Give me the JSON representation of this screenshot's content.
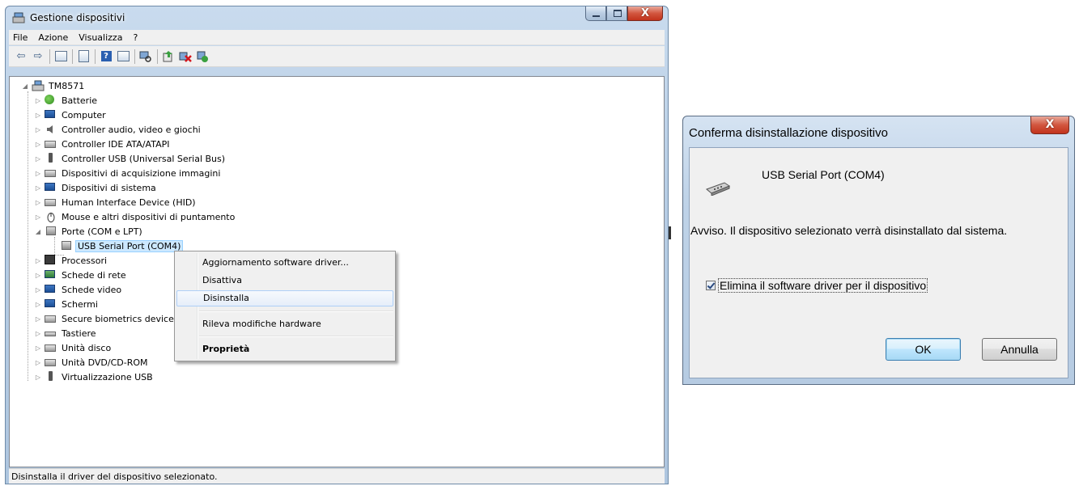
{
  "device_manager": {
    "title": "Gestione dispositivi",
    "menu": [
      "File",
      "Azione",
      "Visualizza",
      "?"
    ],
    "tree": {
      "root": "TM8571",
      "categories": [
        "Batterie",
        "Computer",
        "Controller audio, video e giochi",
        "Controller IDE ATA/ATAPI",
        "Controller USB (Universal Serial Bus)",
        "Dispositivi di acquisizione immagini",
        "Dispositivi di sistema",
        "Human Interface Device (HID)",
        "Mouse e altri dispositivi di puntamento",
        "Porte (COM e LPT)",
        "USB Serial Port (COM4)",
        "Processori",
        "Schede di rete",
        "Schede video",
        "Schermi",
        "Secure biometrics device",
        "Tastiere",
        "Unità disco",
        "Unità DVD/CD-ROM",
        "Virtualizzazione USB"
      ],
      "selected": "USB Serial Port (COM4)"
    },
    "status_text": "Disinstalla il driver del dispositivo selezionato."
  },
  "context_menu": {
    "update_driver": "Aggiornamento software driver...",
    "disable": "Disattiva",
    "uninstall": "Disinstalla",
    "scan_hardware": "Rileva modifiche hardware",
    "properties": "Proprietà",
    "highlighted": "Disinstalla"
  },
  "dialog": {
    "title": "Conferma disinstallazione dispositivo",
    "close_glyph": "X",
    "device_name": "USB Serial Port (COM4)",
    "warning": "Avviso. Il dispositivo selezionato verrà disinstallato dal sistema.",
    "checkbox_label": "Elimina il software driver per il dispositivo",
    "checkbox_checked": true,
    "ok_label": "OK",
    "cancel_label": "Annulla"
  },
  "icons": {
    "title": "device-manager-icon",
    "toolbar": [
      "back-arrow-icon",
      "forward-arrow-icon",
      "console-tree-icon",
      "properties-sheet-icon",
      "help-icon",
      "view-icon",
      "scan-hardware-icon",
      "update-driver-icon",
      "uninstall-icon",
      "enable-icon"
    ]
  },
  "colors": {
    "selection": "#cce8ff",
    "close_button": "#c2331c",
    "window_frame": "#b7cde4"
  }
}
